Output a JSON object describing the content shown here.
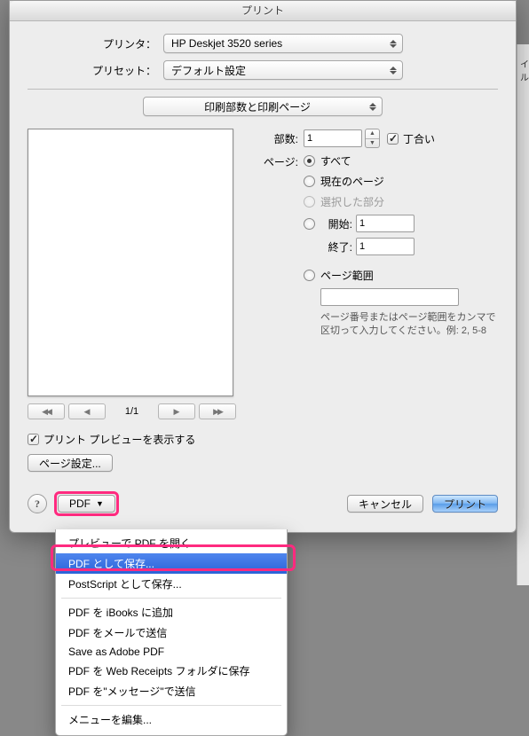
{
  "title": "プリント",
  "labels": {
    "printer": "プリンタ：",
    "preset": "プリセット："
  },
  "printer": {
    "selected": "HP Deskjet 3520 series"
  },
  "preset": {
    "selected": "デフォルト設定"
  },
  "section": {
    "selected": "印刷部数と印刷ページ"
  },
  "copies": {
    "label": "部数:",
    "value": "1",
    "collate_label": "丁合い"
  },
  "pages": {
    "label": "ページ:",
    "all": "すべて",
    "current": "現在のページ",
    "selection": "選択した部分",
    "from_label": "開始:",
    "from": "1",
    "to_label": "終了:",
    "to": "1",
    "range_label": "ページ範囲",
    "range_value": "",
    "hint": "ページ番号またはページ範囲をカンマで区切って入力してください。例: 2, 5-8"
  },
  "preview": {
    "page_indicator": "1/1",
    "show_preview": "プリント プレビューを表示する",
    "page_setup": "ページ設定..."
  },
  "footer": {
    "pdf": "PDF",
    "cancel": "キャンセル",
    "print": "プリント"
  },
  "pdf_menu": {
    "open_preview": "プレビューで PDF を開く",
    "save_as_pdf": "PDF として保存...",
    "save_as_ps": "PostScript として保存...",
    "add_ibooks": "PDF を iBooks に追加",
    "mail": "PDF をメールで送信",
    "adobe": "Save as Adobe PDF",
    "web_receipts": "PDF を Web Receipts フォルダに保存",
    "messages": "PDF を\"メッセージ\"で送信",
    "edit": "メニューを編集..."
  },
  "side_fragment": "イル"
}
